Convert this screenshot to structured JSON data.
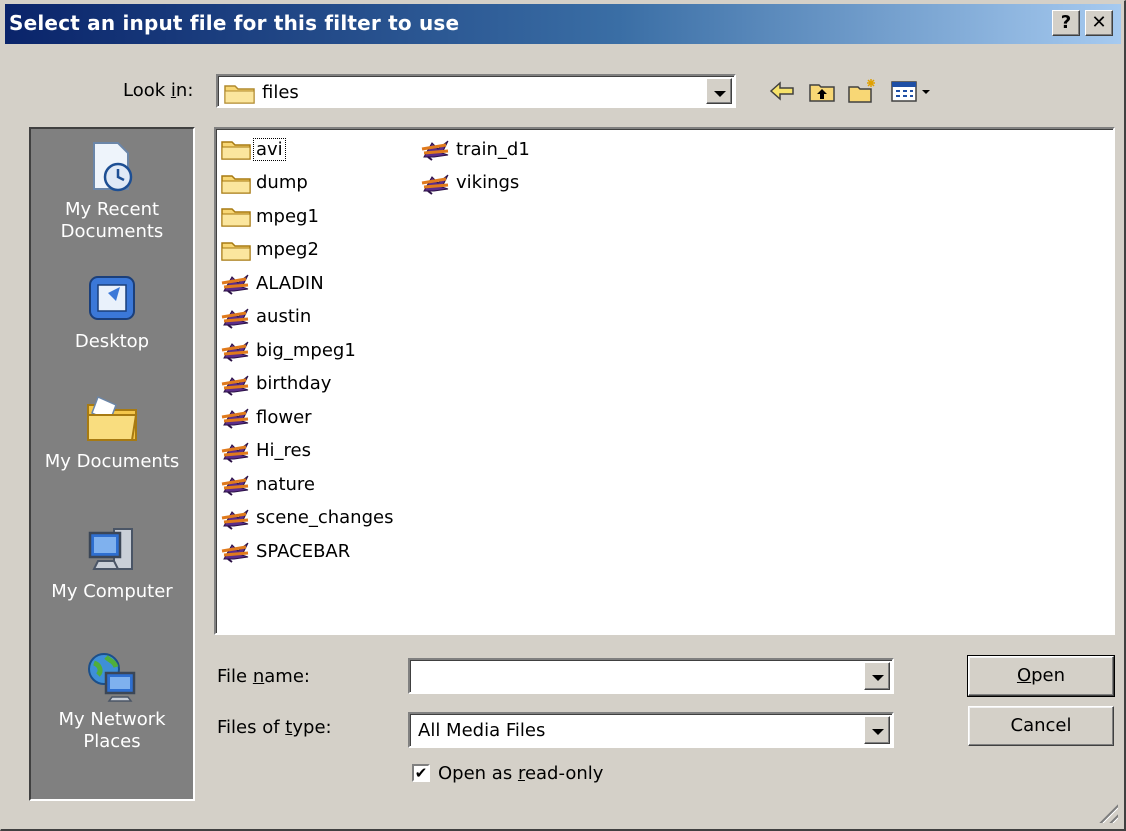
{
  "window": {
    "title": "Select an input file for this filter to use",
    "help_glyph": "?",
    "close_glyph": "✕"
  },
  "look_in": {
    "label_pre": "Look ",
    "label_key": "i",
    "label_post": "n:",
    "value": "files"
  },
  "toolbar": {
    "icons": [
      "back-arrow-icon",
      "up-folder-icon",
      "new-folder-icon",
      "view-menu-icon"
    ]
  },
  "places": [
    {
      "label": "My Recent Documents",
      "icon": "recent-documents-icon"
    },
    {
      "label": "Desktop",
      "icon": "desktop-icon"
    },
    {
      "label": "My Documents",
      "icon": "my-documents-icon"
    },
    {
      "label": "My Computer",
      "icon": "my-computer-icon"
    },
    {
      "label": "My Network Places",
      "icon": "network-places-icon"
    }
  ],
  "files": [
    {
      "name": "avi",
      "type": "folder",
      "selected": true
    },
    {
      "name": "dump",
      "type": "folder"
    },
    {
      "name": "mpeg1",
      "type": "folder"
    },
    {
      "name": "mpeg2",
      "type": "folder"
    },
    {
      "name": "ALADIN",
      "type": "media"
    },
    {
      "name": "austin",
      "type": "media"
    },
    {
      "name": "big_mpeg1",
      "type": "media"
    },
    {
      "name": "birthday",
      "type": "media"
    },
    {
      "name": "flower",
      "type": "media"
    },
    {
      "name": "Hi_res",
      "type": "media"
    },
    {
      "name": "nature",
      "type": "media"
    },
    {
      "name": "scene_changes",
      "type": "media"
    },
    {
      "name": "SPACEBAR",
      "type": "media"
    },
    {
      "name": "train_d1",
      "type": "media"
    },
    {
      "name": "vikings",
      "type": "media"
    }
  ],
  "file_name": {
    "label_pre": "File ",
    "label_key": "n",
    "label_post": "ame:",
    "value": ""
  },
  "files_of_type": {
    "label_pre": "Files of ",
    "label_key": "t",
    "label_post": "ype:",
    "value": "All Media Files"
  },
  "read_only": {
    "label_pre": "Open as ",
    "label_key": "r",
    "label_post": "ead-only",
    "checked": true,
    "check_glyph": "✔"
  },
  "buttons": {
    "open_key": "O",
    "open_rest": "pen",
    "cancel": "Cancel"
  }
}
